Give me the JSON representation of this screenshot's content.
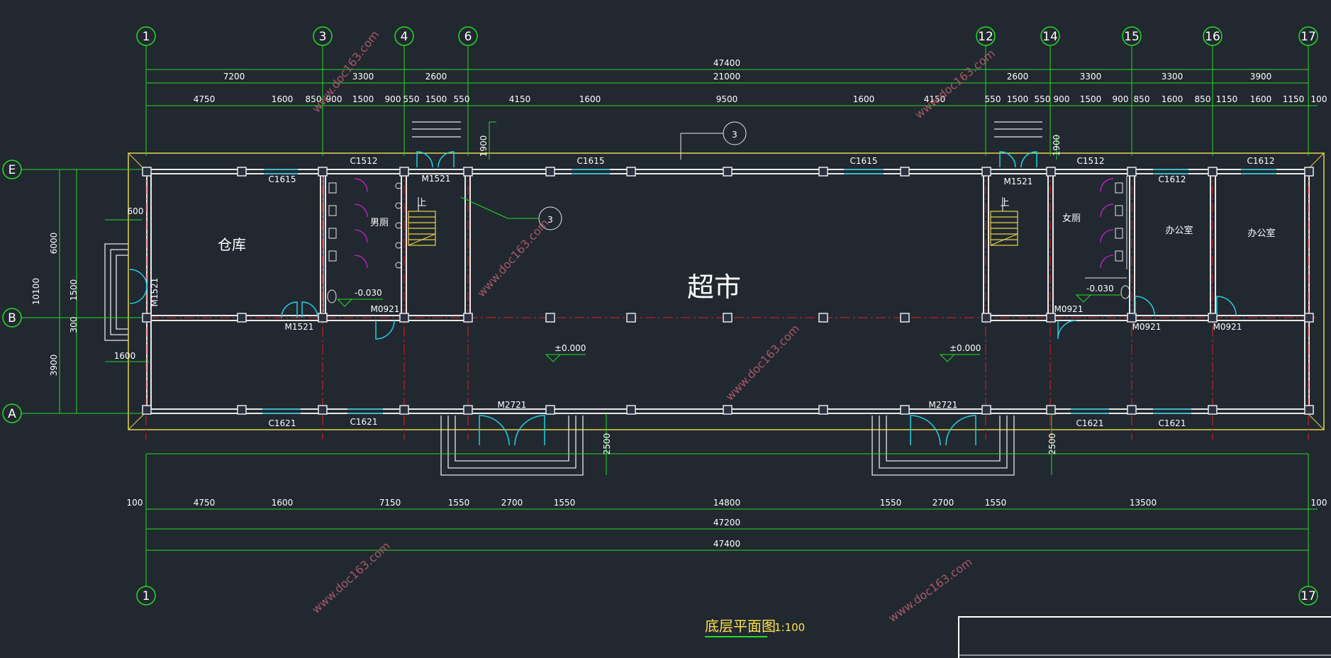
{
  "colors": {
    "background": "#212830",
    "dimension": "#22dd22",
    "wall": "#e8e8e8",
    "outline": "#e6d24a",
    "axis": "#e02020",
    "door": "#20d0e0",
    "fixture": "#d020d0",
    "stair": "#e6d24a",
    "watermark": "#c06070"
  },
  "grid_columns": {
    "top": [
      "1",
      "3",
      "4",
      "6",
      "12",
      "14",
      "15",
      "16",
      "17"
    ],
    "bottom": [
      "1",
      "17"
    ]
  },
  "grid_rows": [
    "E",
    "B",
    "A"
  ],
  "top_dims": {
    "overall": "47400",
    "row2": [
      "7200",
      "3300",
      "2600",
      "21000",
      "2600",
      "3300",
      "3300",
      "3900"
    ],
    "row3": [
      "4750",
      "1600",
      "850",
      "900",
      "1500",
      "900",
      "550",
      "1500",
      "550",
      "4150",
      "1600",
      "9500",
      "1600",
      "4150",
      "550",
      "1500",
      "550",
      "900",
      "1500",
      "900",
      "850",
      "1600",
      "850",
      "1150",
      "1600",
      "1150",
      "100"
    ]
  },
  "bottom_dims": {
    "row1": [
      "100",
      "4750",
      "1600",
      "7150",
      "1550",
      "2700",
      "1550",
      "14800",
      "1550",
      "2700",
      "1550",
      "13500",
      "100"
    ],
    "row2": "47200",
    "row3": "47400"
  },
  "left_dims": {
    "outer": "10100",
    "inner": [
      "6000",
      "3900"
    ],
    "porch": [
      "1500",
      "300"
    ],
    "widths": [
      "600",
      "1600"
    ]
  },
  "other_dims": [
    "1900",
    "1900",
    "2500",
    "2500"
  ],
  "windows": {
    "top": [
      "C1512",
      "C1615",
      "C1615",
      "C1512",
      "C1612"
    ],
    "top_inner": [
      "C1615",
      "C1612"
    ],
    "bottom": [
      "C1621",
      "C1621",
      "C1621",
      "C1621"
    ]
  },
  "doors": {
    "m1521": "M1521",
    "m0921": "M0921",
    "m2721": "M2721"
  },
  "rooms": {
    "warehouse": "仓库",
    "men_toilet": "男厕",
    "women_toilet": "女厕",
    "supermarket": "超市",
    "office": "办公室"
  },
  "stair_up": "上",
  "levels": {
    "toilet": "-0.030",
    "floor": "±0.000"
  },
  "section_marks": [
    "3",
    "3"
  ],
  "watermark": "www.doc163.com",
  "drawing_title": "底层平面图",
  "drawing_scale": "1:100"
}
